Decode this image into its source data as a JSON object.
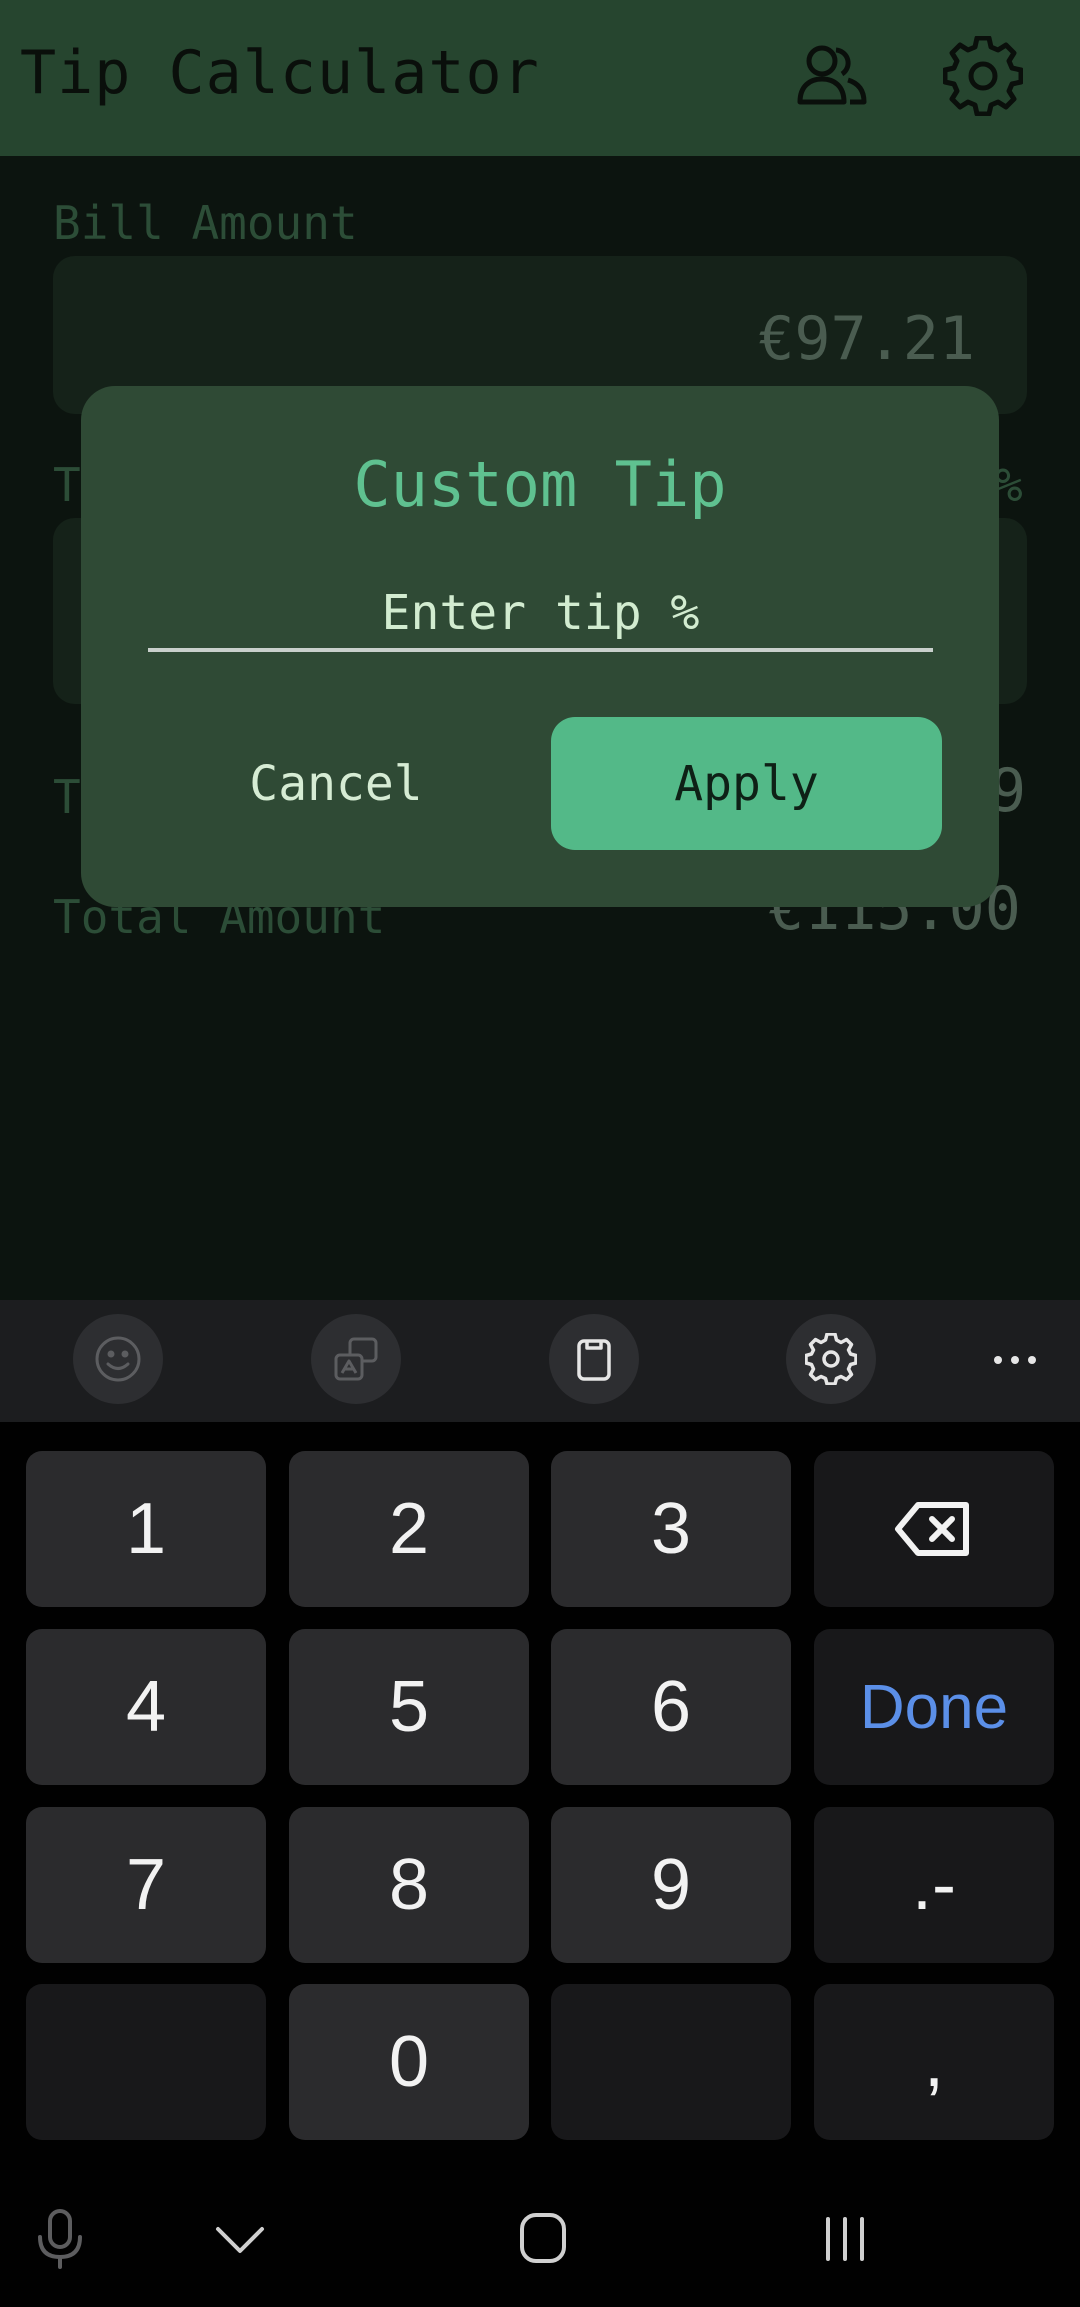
{
  "app": {
    "title": "Tip Calculator",
    "header_icons": [
      "people-icon",
      "gear-icon"
    ]
  },
  "background": {
    "bill_label": "Bill Amount",
    "bill_value": "€97.21",
    "tip_label_fragment": "T",
    "tip_percent_fragment": "%",
    "tip_amount_label_fragment": "T",
    "tip_amount_value_fragment": "9",
    "total_label": "Total Amount",
    "total_value_fragment": "€115.00"
  },
  "dialog": {
    "title": "Custom Tip",
    "input_placeholder": "Enter tip %",
    "input_value": "",
    "cancel_label": "Cancel",
    "apply_label": "Apply"
  },
  "keyboard": {
    "toolbar_icons": [
      "emoji-icon",
      "translate-icon",
      "clipboard-icon",
      "settings-icon",
      "more-icon"
    ],
    "keys": {
      "k1": "1",
      "k2": "2",
      "k3": "3",
      "k4": "4",
      "k5": "5",
      "k6": "6",
      "k7": "7",
      "k8": "8",
      "k9": "9",
      "k0": "0",
      "done": "Done",
      "dot_dash": ".-",
      "comma": ","
    }
  },
  "navbar": {
    "icons": [
      "microphone-icon",
      "chevron-down-icon",
      "home-icon",
      "recents-icon"
    ]
  },
  "colors": {
    "appbar": "#26452f",
    "dialog": "#2f4a35",
    "accent": "#53b988",
    "dialog_title": "#5fc190",
    "done_key": "#5b8fe8"
  }
}
